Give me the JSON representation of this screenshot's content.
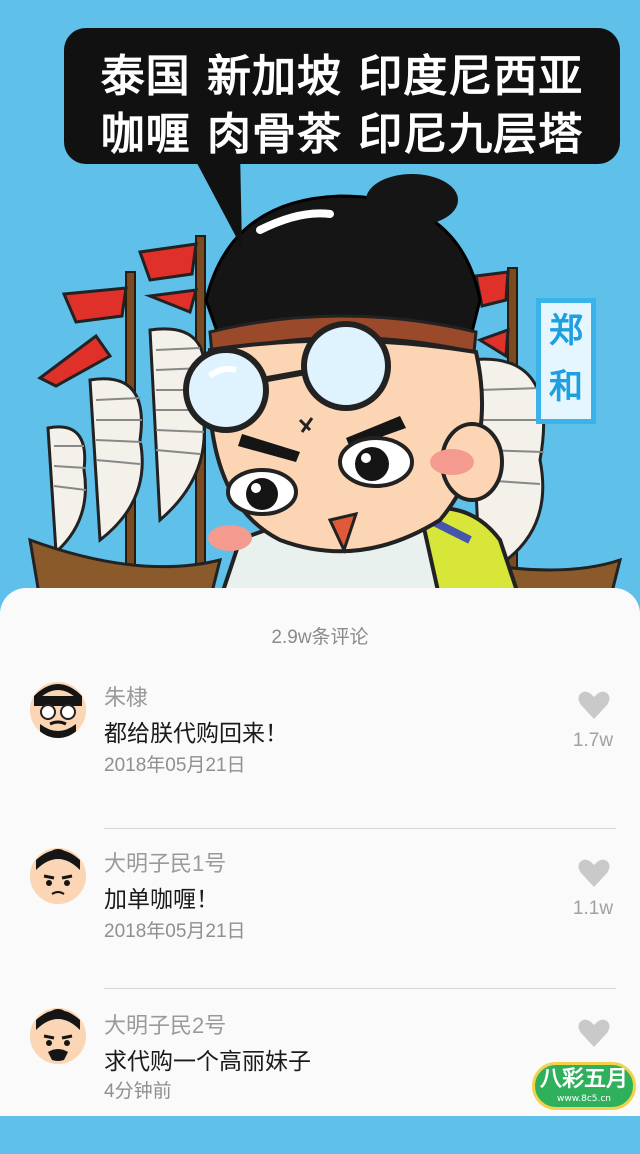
{
  "hero": {
    "bubble_line1": "泰国 新加坡 印度尼西亚",
    "bubble_line2": "咖喱 肉骨茶 印尼九层塔",
    "name_tag": "郑和",
    "colors": {
      "sky": "#5fc0ea",
      "bubble": "#111111",
      "flag": "#e0302a"
    }
  },
  "comments_header": {
    "count_label": "2.9w条评论"
  },
  "comments": [
    {
      "user": "朱棣",
      "text": "都给朕代购回来！",
      "time": "2018年05月21日",
      "likes": "1.7w",
      "avatar_icon": "emperor-avatar-icon"
    },
    {
      "user": "大明子民1号",
      "text": "加单咖喱！",
      "time": "2018年05月21日",
      "likes": "1.1w",
      "avatar_icon": "citizen-avatar-icon"
    },
    {
      "user": "大明子民2号",
      "text": "求代购一个高丽妹子",
      "time": "4分钟前",
      "likes": "",
      "avatar_icon": "citizen-avatar-icon"
    }
  ],
  "watermark": {
    "main": "八彩五月",
    "sub": "www.8c5.cn"
  }
}
